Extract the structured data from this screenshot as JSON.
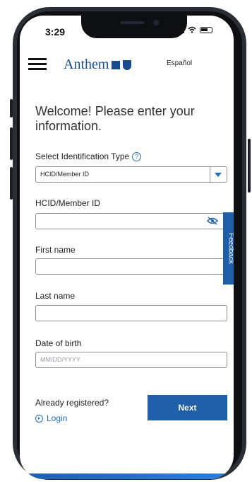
{
  "status": {
    "time": "3:29"
  },
  "header": {
    "brand": "Anthem",
    "language_link": "Español"
  },
  "form": {
    "welcome": "Welcome! Please enter your information.",
    "id_type_label": "Select Identification Type",
    "id_type_value": "HCID/Member ID",
    "member_id_label": "HCID/Member ID",
    "member_id_value": "",
    "first_name_label": "First name",
    "first_name_value": "",
    "last_name_label": "Last name",
    "last_name_value": "",
    "dob_label": "Date of birth",
    "dob_placeholder": "MM/DD/YYYY"
  },
  "feedback_tab": "Feedback",
  "footer": {
    "already_registered": "Already registered?",
    "login_link": "Login",
    "next_button": "Next"
  },
  "colors": {
    "brand_blue": "#1f5ea8",
    "link_blue": "#1f70c1"
  }
}
